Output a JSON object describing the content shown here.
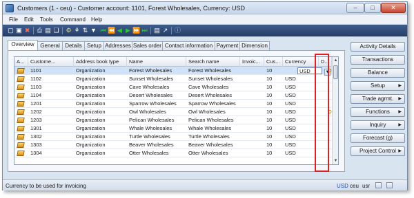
{
  "window": {
    "title": "Customers (1 - ceu) - Customer account: 1101, Forest Wholesales, Currency: USD"
  },
  "menu": [
    "File",
    "Edit",
    "Tools",
    "Command",
    "Help"
  ],
  "tabs": [
    "Overview",
    "General",
    "Details",
    "Setup",
    "Addresses",
    "Sales order",
    "Contact information",
    "Payment",
    "Dimension"
  ],
  "grid": {
    "columns": [
      "A...",
      "Custome...",
      "Address book type",
      "Name",
      "Search name",
      "Invoic...",
      "Cus...",
      "Currency",
      "D..."
    ],
    "rows": [
      {
        "account": "1101",
        "type": "Organization",
        "name": "Forest Wholesales",
        "search": "Forest Wholesales",
        "group": "10",
        "currency": "USD",
        "note": true
      },
      {
        "account": "1102",
        "type": "Organization",
        "name": "Sunset Wholesales",
        "search": "Sunset Wholesales",
        "group": "10",
        "currency": "USD",
        "note": false
      },
      {
        "account": "1103",
        "type": "Organization",
        "name": "Cave Wholesales",
        "search": "Cave Wholesales",
        "group": "10",
        "currency": "USD",
        "note": false
      },
      {
        "account": "1104",
        "type": "Organization",
        "name": "Desert Wholesales",
        "search": "Desert Wholesales",
        "group": "10",
        "currency": "USD",
        "note": false
      },
      {
        "account": "1201",
        "type": "Organization",
        "name": "Sparrow Wholesales",
        "search": "Sparrow Wholesales",
        "group": "10",
        "currency": "USD",
        "note": false
      },
      {
        "account": "1202",
        "type": "Organization",
        "name": "Owl Wholesales",
        "search": "Owl Wholesales",
        "group": "10",
        "currency": "USD",
        "note": true
      },
      {
        "account": "1203",
        "type": "Organization",
        "name": "Pelican Wholesales",
        "search": "Pelican Wholesales",
        "group": "10",
        "currency": "USD",
        "note": false
      },
      {
        "account": "1301",
        "type": "Organization",
        "name": "Whale Wholesales",
        "search": "Whale Wholesales",
        "group": "10",
        "currency": "USD",
        "note": false
      },
      {
        "account": "1302",
        "type": "Organization",
        "name": "Turtle Wholesales",
        "search": "Turtle Wholesales",
        "group": "10",
        "currency": "USD",
        "note": false
      },
      {
        "account": "1303",
        "type": "Organization",
        "name": "Beaver Wholesales",
        "search": "Beaver Wholesales",
        "group": "10",
        "currency": "USD",
        "note": false
      },
      {
        "account": "1304",
        "type": "Organization",
        "name": "Otter Wholesales",
        "search": "Otter Wholesales",
        "group": "10",
        "currency": "USD",
        "note": false
      }
    ]
  },
  "side_buttons": [
    {
      "label": "Activity Details",
      "arrow": false
    },
    {
      "label": "Transactions",
      "arrow": false
    },
    {
      "label": "Balance",
      "arrow": false
    },
    {
      "label": "Setup",
      "arrow": true
    },
    {
      "label": "Trade agrmt.",
      "arrow": true
    },
    {
      "label": "Functions",
      "arrow": true
    },
    {
      "label": "Inquiry",
      "arrow": true
    },
    {
      "label": "Forecast (g)",
      "arrow": false
    },
    {
      "label": "Project Control",
      "arrow": true
    }
  ],
  "status": {
    "text": "Currency to be used for invoicing",
    "currency": "USD",
    "company": "ceu",
    "layer": "usr"
  },
  "colors": {
    "highlight": "#e02020",
    "toolbar": "#28406a",
    "selected_row": "#cfe2f8"
  }
}
